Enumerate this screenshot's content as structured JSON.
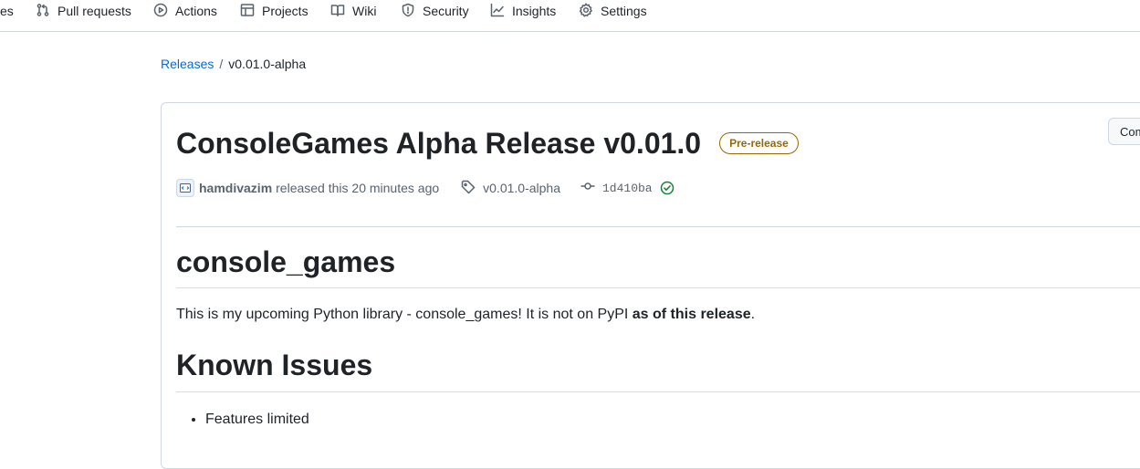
{
  "nav": {
    "cut_label": "es",
    "items": [
      {
        "label": "Pull requests",
        "icon": "pull-request-icon"
      },
      {
        "label": "Actions",
        "icon": "play-icon"
      },
      {
        "label": "Projects",
        "icon": "table-icon"
      },
      {
        "label": "Wiki",
        "icon": "book-icon"
      },
      {
        "label": "Security",
        "icon": "shield-icon"
      },
      {
        "label": "Insights",
        "icon": "graph-icon"
      },
      {
        "label": "Settings",
        "icon": "gear-icon"
      }
    ]
  },
  "breadcrumb": {
    "root": "Releases",
    "separator": "/",
    "current": "v0.01.0-alpha"
  },
  "release": {
    "title": "ConsoleGames Alpha Release v0.01.0",
    "badge": "Pre-release",
    "compare_label": "Com",
    "author": "hamdivazim",
    "released_text": "released this 20 minutes ago",
    "tag": "v0.01.0-alpha",
    "commit": "1d410ba",
    "verified": true
  },
  "body": {
    "heading": "console_games",
    "paragraph_prefix": "This is my upcoming Python library - console_games! It is not on PyPI ",
    "paragraph_bold": "as of this release",
    "paragraph_suffix": ".",
    "issues_heading": "Known Issues",
    "issues": [
      "Features limited"
    ]
  },
  "colors": {
    "link": "#0969da",
    "badge": "#9a6700",
    "success": "#1a7f37",
    "border": "#d0d7de"
  }
}
